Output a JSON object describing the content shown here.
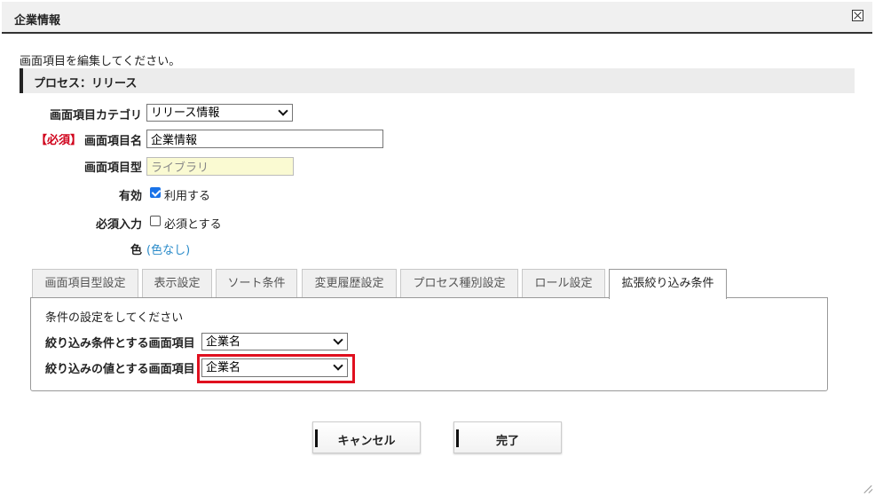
{
  "window": {
    "title": "企業情報"
  },
  "instruction": "画面項目を編集してください。",
  "section": {
    "title": "プロセス：リリース"
  },
  "form": {
    "category": {
      "label": "画面項目カテゴリ",
      "value": "リリース情報"
    },
    "name": {
      "required_tag": "【必須】",
      "label": "画面項目名",
      "value": "企業情報"
    },
    "type": {
      "label": "画面項目型",
      "value": "ライブラリ"
    },
    "enabled": {
      "label": "有効",
      "checkbox_label": "利用する",
      "checked": true
    },
    "required_input": {
      "label": "必須入力",
      "checkbox_label": "必須とする",
      "checked": false
    },
    "color": {
      "label": "色",
      "value": "(色なし)"
    }
  },
  "tabs": [
    {
      "label": "画面項目型設定"
    },
    {
      "label": "表示設定"
    },
    {
      "label": "ソート条件"
    },
    {
      "label": "変更履歴設定"
    },
    {
      "label": "プロセス種別設定"
    },
    {
      "label": "ロール設定"
    },
    {
      "label": "拡張絞り込み条件",
      "active": true
    }
  ],
  "panel": {
    "description": "条件の設定をしてください",
    "filter_item": {
      "label": "絞り込み条件とする画面項目",
      "value": "企業名"
    },
    "filter_value_item": {
      "label": "絞り込みの値とする画面項目",
      "value": "企業名"
    }
  },
  "buttons": {
    "cancel": "キャンセル",
    "done": "完了"
  },
  "colors": {
    "required": "#d0021b",
    "link": "#2a8bc9",
    "highlight": "#e0101f",
    "readonly_bg": "#fafad2"
  }
}
